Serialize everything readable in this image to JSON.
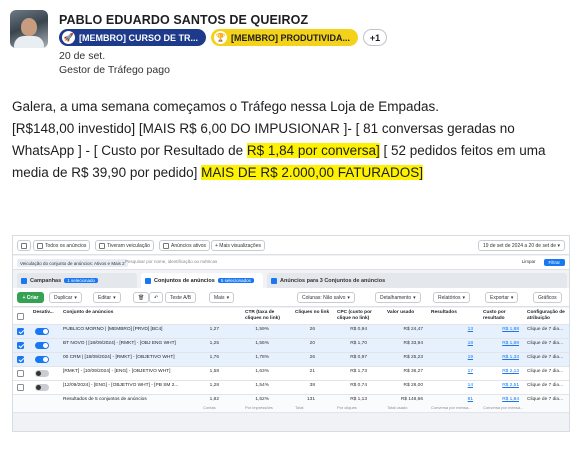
{
  "post": {
    "author": "PABLO EDUARDO SANTOS DE QUEIROZ",
    "badges": [
      {
        "icon": "rocket-badge-icon",
        "label": "[MEMBRO] CURSO DE TR..."
      },
      {
        "icon": "trophy-badge-icon",
        "label": "[MEMBRO] PRODUTIVIDA..."
      }
    ],
    "more_badges": "+1",
    "date": "20 de set.",
    "role": "Gestor de Tráfego pago",
    "text": {
      "p1": "Galera, a uma semana começamos o Tráfego nessa Loja de Empadas.",
      "p2a": "[R$148,00 investido] [MAIS R$ 6,00 DO IMPUSIONAR ]- [ 81 conversas geradas no WhatsApp ] - [ Custo por Resultado de ",
      "p2_hl1": "R$ 1,84 por conversa]",
      "p2b": " [ 52 pedidos feitos em uma media de R$ 39,90 por pedido] ",
      "p2_hl2": "MAIS DE R$ 2.000,00 FATURADOS]"
    },
    "colors": {
      "badge_blue": "#1e3a8a",
      "badge_yellow": "#f4d21a",
      "highlight": "#fff200"
    }
  },
  "ads_manager": {
    "toolbar": {
      "chips": [
        "Todos os anúncios",
        "Tiveram veiculação",
        "Anúncios ativos",
        "+ Mais visualizações"
      ],
      "date_range": "19 de set de 2024 a 20 de set de"
    },
    "search": {
      "filter": "Veiculação do conjunto de anúncios: Ativos e Mais 2",
      "placeholder": "Pesquisar por nome, identificação ou métricas",
      "links": [
        "Limpar",
        "Filtrar"
      ]
    },
    "levels": {
      "campaigns": "Campanhas",
      "campaigns_sel": "1 selecionado",
      "adsets": "Conjuntos de anúncios",
      "adsets_sel": "5 selecionados",
      "ads": "Anúncios para 3 Conjuntos de anúncios"
    },
    "actions": {
      "create": "+ Criar",
      "duplicate": "Duplicar",
      "edit": "Editar",
      "ab_test": "Teste A/B",
      "more": "Mais",
      "columns": "Colunas: Não salvo",
      "breakdown": "Detalhamento",
      "reports": "Relatórios",
      "export": "Exportar",
      "charts": "Gráficos"
    },
    "columns": [
      "Desativ...",
      "Conjunto de anúncios",
      "CTR (taxa de cliques no link)",
      "Cliques no link",
      "CPC (custo por clique no link)",
      "Valor usado",
      "Resultados",
      "Custo por resultado",
      "Configuração de atribuição"
    ],
    "rows": [
      {
        "selected": true,
        "on": true,
        "name": "PUBLICO MORNO | [MEMBRO] [PRVD] [BC4]",
        "ctr": "1,27",
        "ctr_b": "1,59%",
        "clicks": "26",
        "cpc": "R$ 0,94",
        "spent": "R$ 24,47",
        "results": "13",
        "cpr": "R$ 1,88",
        "attr": "Clique de 7 dia..."
      },
      {
        "selected": true,
        "on": true,
        "name": "BT NOVO | [18/09/2024] - [RMKT] - [OBJ ENG WHT]",
        "ctr": "1,25",
        "ctr_b": "1,55%",
        "clicks": "20",
        "cpc": "R$ 1,70",
        "spent": "R$ 33,94",
        "results": "18",
        "cpr": "R$ 1,89",
        "attr": "Clique de 7 dia..."
      },
      {
        "selected": true,
        "on": true,
        "name": "00 CRM | [18/09/2024] - [RMKT] - [OBJETIVO WHT]",
        "ctr": "1,76",
        "ctr_b": "1,78%",
        "clicks": "26",
        "cpc": "R$ 0,97",
        "spent": "R$ 25,23",
        "results": "19",
        "cpr": "R$ 1,33",
        "attr": "Clique de 7 dia..."
      },
      {
        "selected": false,
        "on": false,
        "name": "[RMKT] - [10/09/2024] - [ENG] - [OBJETIVO WHT]",
        "ctr": "1,58",
        "ctr_b": "1,63%",
        "clicks": "21",
        "cpc": "R$ 1,73",
        "spent": "R$ 36,27",
        "results": "17",
        "cpr": "R$ 2,13",
        "attr": "Clique de 7 dia..."
      },
      {
        "selected": false,
        "on": false,
        "name": "[12/09/2024] - [ENG] - [OBJETIVO WHT] - [PB SM 2...",
        "ctr": "1,28",
        "ctr_b": "1,54%",
        "clicks": "38",
        "cpc": "R$ 0,74",
        "spent": "R$ 28,00",
        "results": "14",
        "cpr": "R$ 2,51",
        "attr": "Clique de 7 dia..."
      }
    ],
    "totals": {
      "label": "Resultados de 5 conjuntos de anúncios",
      "ctr": "1,82",
      "ctr_b": "1,52%",
      "clicks": "131",
      "cpc": "R$ 1,13",
      "spent": "R$ 148,66",
      "results": "81",
      "cpr": "R$ 1,84",
      "attr": "Clique de 7 dia..."
    },
    "total_sub": [
      "Contas",
      "Por impressões",
      "Total",
      "Por cliques",
      "Total usado",
      "Conversa por mensa...",
      "Conversa por mensa..."
    ]
  }
}
